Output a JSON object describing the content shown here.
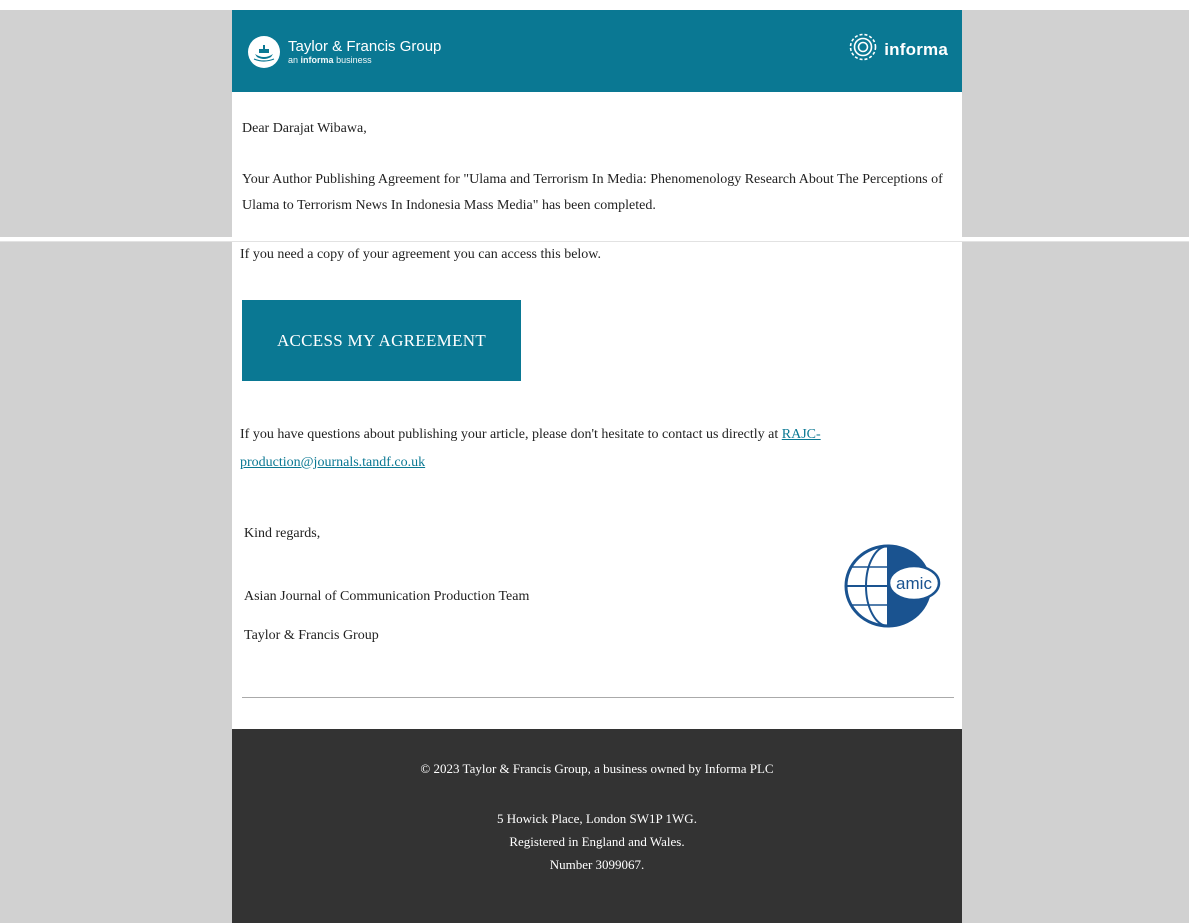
{
  "header": {
    "brand_name": "Taylor & Francis Group",
    "brand_tagline_prefix": "an",
    "brand_tagline_bold": "informa",
    "brand_tagline_suffix": "business",
    "partner_logo_text": "informa",
    "background_color": "#0a7893"
  },
  "body": {
    "greeting": "Dear Darajat Wibawa,",
    "completion_message": "Your Author Publishing Agreement for \"Ulama and Terrorism In Media: Phenomenology Research About The Perceptions of Ulama to Terrorism News In Indonesia Mass Media\" has been completed.",
    "copy_note": "If you need a copy of your agreement you can access this below.",
    "cta_label": "ACCESS MY AGREEMENT",
    "questions_text": "If you have questions about publishing your article, please don't hesitate to contact us directly at ",
    "contact_email": "RAJC-production@journals.tandf.co.uk",
    "closing": "Kind regards,",
    "team_name": "Asian Journal of Communication Production Team",
    "company": "Taylor & Francis Group",
    "journal_logo_text": "amic"
  },
  "footer": {
    "copyright": "© 2023 Taylor & Francis Group, a business owned by Informa PLC",
    "address": "5 Howick Place, London SW1P 1WG.",
    "registration": "Registered in England and Wales.",
    "company_number": "Number 3099067.",
    "background_color": "#333333"
  },
  "icons": [
    "tf-ship-logo-icon",
    "informa-swirl-icon",
    "amic-globe-icon"
  ]
}
